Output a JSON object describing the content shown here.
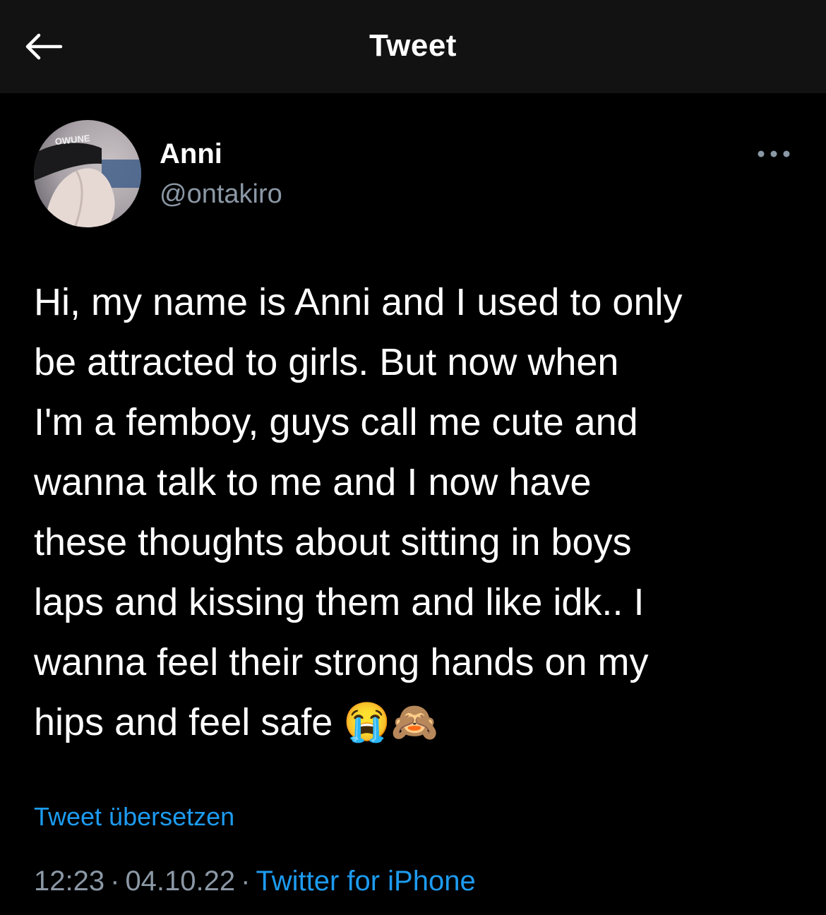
{
  "header": {
    "title": "Tweet",
    "back_icon": "arrow-left-icon"
  },
  "author": {
    "display_name": "Anni",
    "handle": "@ontakiro",
    "avatar_text": "OWUNE",
    "more_icon": "more-horizontal-icon"
  },
  "tweet": {
    "text": "Hi, my name is Anni and I used to only\nbe attracted to girls. But now when\nI'm a femboy, guys call me cute and\nwanna talk to me and I now have\nthese thoughts about sitting in boys\nlaps and kissing them and like idk.. I\nwanna feel their strong hands on my\nhips and feel safe 😭🙈",
    "translate_label": "Tweet übersetzen"
  },
  "meta": {
    "time": "12:23",
    "separator": "·",
    "date": "04.10.22",
    "source": "Twitter for iPhone"
  },
  "colors": {
    "background": "#000000",
    "header_background": "#121212",
    "link": "#1d9bf0",
    "secondary_text": "#8b98a5"
  }
}
